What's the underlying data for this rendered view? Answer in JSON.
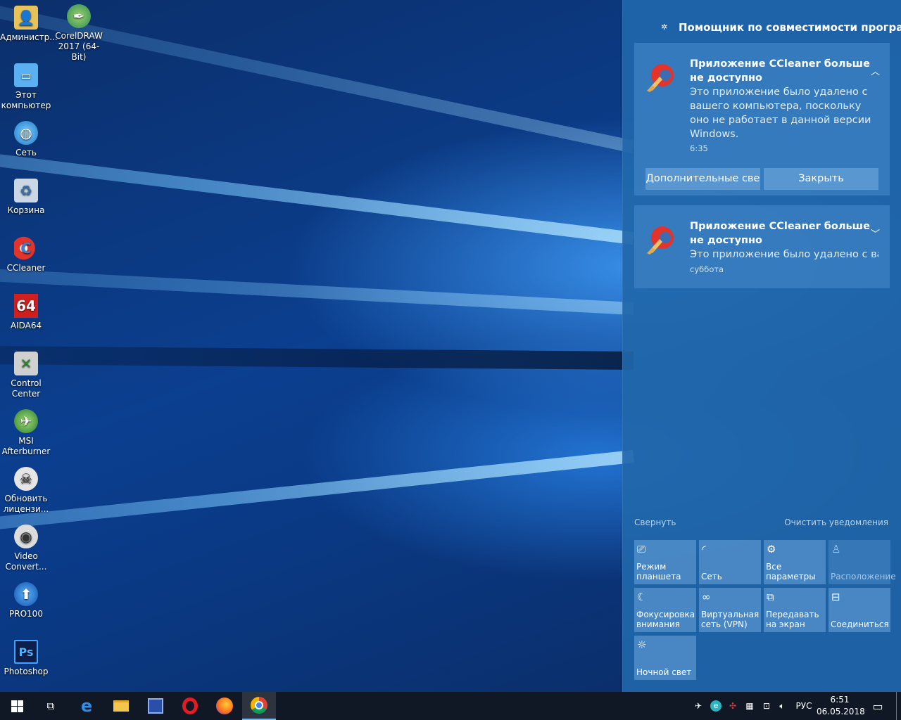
{
  "desktop": {
    "icons": [
      {
        "label": "Администр...",
        "icon": "user-folder-icon"
      },
      {
        "label": "CorelDRAW 2017 (64-Bit)",
        "icon": "coreldraw-icon"
      },
      {
        "label": "Этот компьютер",
        "icon": "computer-icon"
      },
      {
        "label": "Сеть",
        "icon": "network-icon"
      },
      {
        "label": "Корзина",
        "icon": "recycle-bin-icon"
      },
      {
        "label": "CCleaner",
        "icon": "ccleaner-icon"
      },
      {
        "label": "AIDA64",
        "icon": "aida64-icon"
      },
      {
        "label": "Control Center",
        "icon": "control-center-icon"
      },
      {
        "label": "MSI Afterburner",
        "icon": "msi-afterburner-icon"
      },
      {
        "label": "Обновить лицензи...",
        "icon": "update-license-icon"
      },
      {
        "label": "Video Convert...",
        "icon": "video-converter-icon"
      },
      {
        "label": "PRO100",
        "icon": "pro100-icon"
      },
      {
        "label": "Photoshop",
        "icon": "photoshop-icon"
      }
    ]
  },
  "action_center": {
    "header": "Помощник по совместимости програ",
    "notifications": [
      {
        "title": "Приложение CCleaner больше не доступно",
        "body": "Это приложение было удалено с вашего компьютера, поскольку оно не работает в данной версии Windows.",
        "time": "6:35",
        "button_more": "Дополнительные све",
        "button_close": "Закрыть"
      },
      {
        "title": "Приложение CCleaner больше не доступно",
        "body": "Это приложение было удалено с ва",
        "time": "суббота"
      }
    ],
    "collapse_label": "Свернуть",
    "clear_label": "Очистить уведомления",
    "tiles": [
      {
        "label": "Режим планшета",
        "icon": "tablet-mode-icon"
      },
      {
        "label": "Сеть",
        "icon": "network-icon"
      },
      {
        "label": "Все параметры",
        "icon": "gear-icon"
      },
      {
        "label": "Расположение",
        "icon": "location-icon"
      },
      {
        "label": "Фокусировка внимания",
        "icon": "moon-icon"
      },
      {
        "label": "Виртуальная сеть (VPN)",
        "icon": "vpn-icon"
      },
      {
        "label": "Передавать на экран",
        "icon": "project-icon"
      },
      {
        "label": "Соединиться",
        "icon": "connect-icon"
      },
      {
        "label": "Ночной свет",
        "icon": "brightness-icon"
      }
    ]
  },
  "taskbar": {
    "language": "РУС",
    "time": "6:51",
    "date": "06.05.2018"
  }
}
